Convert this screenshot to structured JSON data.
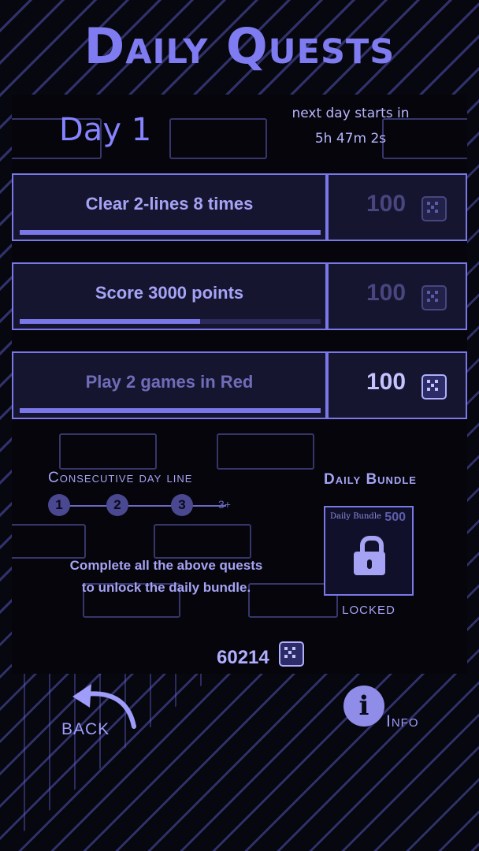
{
  "title": "Daily Quests",
  "day": {
    "label": "Day 1",
    "next_day_label": "next day starts in",
    "countdown": "5h 47m 2s"
  },
  "quests": [
    {
      "label": "Clear 2-lines 8 times",
      "reward": "100",
      "progress": 1.0,
      "reward_active": false,
      "label_dim": false
    },
    {
      "label": "Score 3000 points",
      "reward": "100",
      "progress": 0.6,
      "reward_active": false,
      "label_dim": false
    },
    {
      "label": "Play 2 games in Red",
      "reward": "100",
      "progress": 1.0,
      "reward_active": true,
      "label_dim": true
    }
  ],
  "streak": {
    "title": "Consecutive day line",
    "steps": [
      "1",
      "2",
      "3"
    ],
    "more": "3+"
  },
  "hint": {
    "line1": "Complete all the above quests",
    "line2": "to unlock the daily bundle."
  },
  "bundle": {
    "title": "Daily Bundle",
    "card_name": "Daily Bundle",
    "price": "500",
    "status": "LOCKED"
  },
  "balance": "60214",
  "nav": {
    "back_label": "Back",
    "info_label": "Info",
    "info_glyph": "i"
  },
  "colors": {
    "accent": "#7f7bf0",
    "panel": "#151530",
    "border": "#7a77e8"
  }
}
